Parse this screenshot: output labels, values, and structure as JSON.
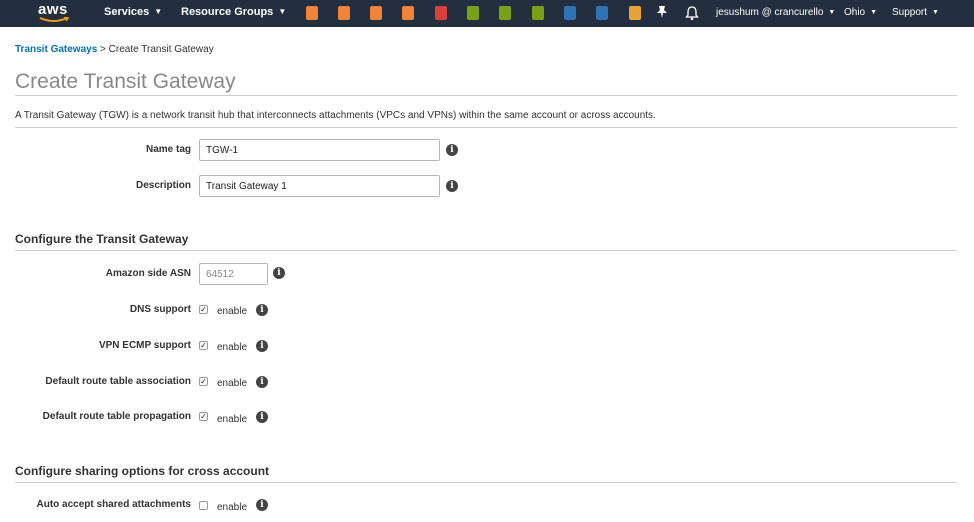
{
  "nav": {
    "logo": "aws",
    "services_label": "Services",
    "resource_groups_label": "Resource Groups",
    "service_icons": [
      {
        "name": "ec2-icon",
        "color": "#f58536"
      },
      {
        "name": "lambda-icon",
        "color": "#f58536"
      },
      {
        "name": "ecs-icon",
        "color": "#f58536"
      },
      {
        "name": "elastic-beanstalk-icon",
        "color": "#f58536"
      },
      {
        "name": "ecr-icon",
        "color": "#d9403a"
      },
      {
        "name": "vpc-icon",
        "color": "#7aa116"
      },
      {
        "name": "route53-icon",
        "color": "#7aa116"
      },
      {
        "name": "cloudfront-icon",
        "color": "#7aa116"
      },
      {
        "name": "dynamodb-icon",
        "color": "#2e73b8"
      },
      {
        "name": "rds-icon",
        "color": "#2e73b8"
      },
      {
        "name": "s3-icon",
        "color": "#e7a335"
      }
    ],
    "account_label": "jesushum @ crancurello",
    "region_label": "Ohio",
    "support_label": "Support",
    "caret": "▼"
  },
  "breadcrumb": {
    "parent": "Transit Gateways",
    "separator": ">",
    "current": "Create Transit Gateway"
  },
  "page_title": "Create Transit Gateway",
  "description": "A Transit Gateway (TGW) is a network transit hub that interconnects attachments (VPCs and VPNs) within the same account or across accounts.",
  "form": {
    "name_tag": {
      "label": "Name tag",
      "value": "TGW-1"
    },
    "description": {
      "label": "Description",
      "value": "Transit Gateway 1"
    }
  },
  "configure_section": {
    "title": "Configure the Transit Gateway",
    "asn": {
      "label": "Amazon side ASN",
      "value": "64512"
    },
    "options": [
      {
        "label": "DNS support",
        "checked": true,
        "enable_label": "enable"
      },
      {
        "label": "VPN ECMP support",
        "checked": true,
        "enable_label": "enable"
      },
      {
        "label": "Default route table association",
        "checked": true,
        "enable_label": "enable"
      },
      {
        "label": "Default route table propagation",
        "checked": true,
        "enable_label": "enable"
      }
    ]
  },
  "sharing_section": {
    "title": "Configure sharing options for cross account",
    "auto_accept": {
      "label": "Auto accept shared attachments",
      "checked": false,
      "enable_label": "enable"
    }
  },
  "info_glyph": "i",
  "check_glyph": "✓"
}
